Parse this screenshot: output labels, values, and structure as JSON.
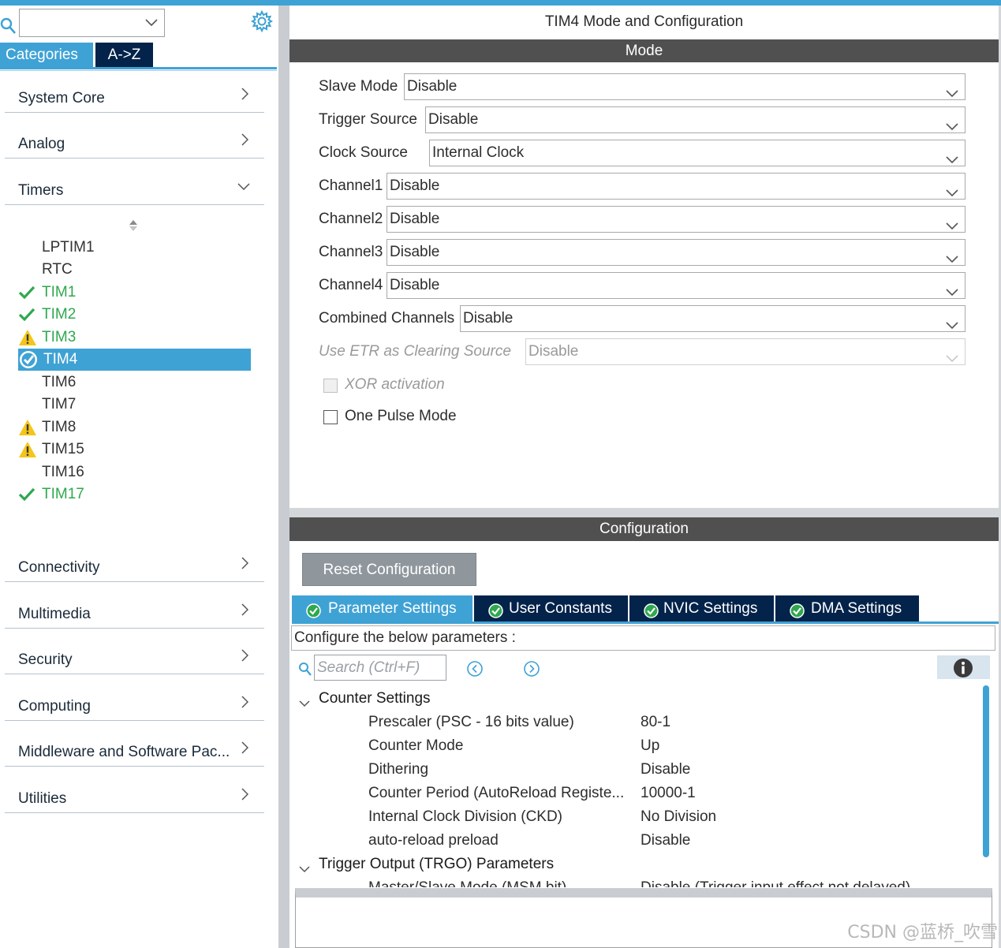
{
  "window": {
    "title": "TIM4 Mode and Configuration"
  },
  "left": {
    "combo_value": "",
    "tabs": {
      "categories": "Categories",
      "az": "A->Z"
    },
    "categories": [
      {
        "label": "System Core",
        "state": "collapsed"
      },
      {
        "label": "Analog",
        "state": "collapsed"
      },
      {
        "label": "Timers",
        "state": "expanded"
      },
      {
        "label": "Connectivity",
        "state": "collapsed"
      },
      {
        "label": "Multimedia",
        "state": "collapsed"
      },
      {
        "label": "Security",
        "state": "collapsed"
      },
      {
        "label": "Computing",
        "state": "collapsed"
      },
      {
        "label": "Middleware and Software Pac...",
        "state": "collapsed"
      },
      {
        "label": "Utilities",
        "state": "collapsed"
      }
    ],
    "timers": [
      {
        "label": "LPTIM1",
        "status": "none"
      },
      {
        "label": "RTC",
        "status": "none"
      },
      {
        "label": "TIM1",
        "status": "ok"
      },
      {
        "label": "TIM2",
        "status": "ok"
      },
      {
        "label": "TIM3",
        "status": "warning"
      },
      {
        "label": "TIM4",
        "status": "selected"
      },
      {
        "label": "TIM6",
        "status": "none"
      },
      {
        "label": "TIM7",
        "status": "none"
      },
      {
        "label": "TIM8",
        "status": "warning"
      },
      {
        "label": "TIM15",
        "status": "warning"
      },
      {
        "label": "TIM16",
        "status": "none"
      },
      {
        "label": "TIM17",
        "status": "ok"
      }
    ]
  },
  "mode": {
    "header": "Mode",
    "rows": [
      {
        "label": "Slave Mode",
        "value": "Disable",
        "enabled": true
      },
      {
        "label": "Trigger Source",
        "value": "Disable",
        "enabled": true
      },
      {
        "label": "Clock Source",
        "value": "Internal Clock",
        "enabled": true
      },
      {
        "label": "Channel1",
        "value": "Disable",
        "enabled": true
      },
      {
        "label": "Channel2",
        "value": "Disable",
        "enabled": true
      },
      {
        "label": "Channel3",
        "value": "Disable",
        "enabled": true
      },
      {
        "label": "Channel4",
        "value": "Disable",
        "enabled": true
      },
      {
        "label": "Combined Channels",
        "value": "Disable",
        "enabled": true
      },
      {
        "label": "Use ETR as Clearing Source",
        "value": "Disable",
        "enabled": false
      }
    ],
    "checkboxes": [
      {
        "label": "XOR activation",
        "checked": false,
        "enabled": false
      },
      {
        "label": "One Pulse Mode",
        "checked": false,
        "enabled": true
      }
    ]
  },
  "configuration": {
    "header": "Configuration",
    "reset_label": "Reset Configuration",
    "tabs": [
      {
        "label": "Parameter Settings",
        "active": true
      },
      {
        "label": "User Constants",
        "active": false
      },
      {
        "label": "NVIC Settings",
        "active": false
      },
      {
        "label": "DMA Settings",
        "active": false
      }
    ],
    "hint": "Configure the below parameters :",
    "search_placeholder": "Search (Ctrl+F)",
    "groups": [
      {
        "title": "Counter Settings",
        "params": [
          {
            "name": "Prescaler (PSC - 16 bits value)",
            "value": "80-1"
          },
          {
            "name": "Counter Mode",
            "value": "Up"
          },
          {
            "name": "Dithering",
            "value": "Disable"
          },
          {
            "name": "Counter Period (AutoReload Registe...",
            "value": "10000-1"
          },
          {
            "name": "Internal Clock Division (CKD)",
            "value": "No Division"
          },
          {
            "name": "auto-reload preload",
            "value": "Disable"
          }
        ]
      },
      {
        "title": "Trigger Output (TRGO) Parameters",
        "params": [
          {
            "name": "Master/Slave Mode (MSM bit)",
            "value": "Disable (Trigger input effect not delayed)"
          }
        ]
      }
    ]
  },
  "watermark": "CSDN @蓝桥_吹雪",
  "colors": {
    "accent": "#3fa2d5",
    "navy": "#03234b",
    "ok": "#2fa84f",
    "warning": "#f5c518",
    "section": "#505050"
  }
}
